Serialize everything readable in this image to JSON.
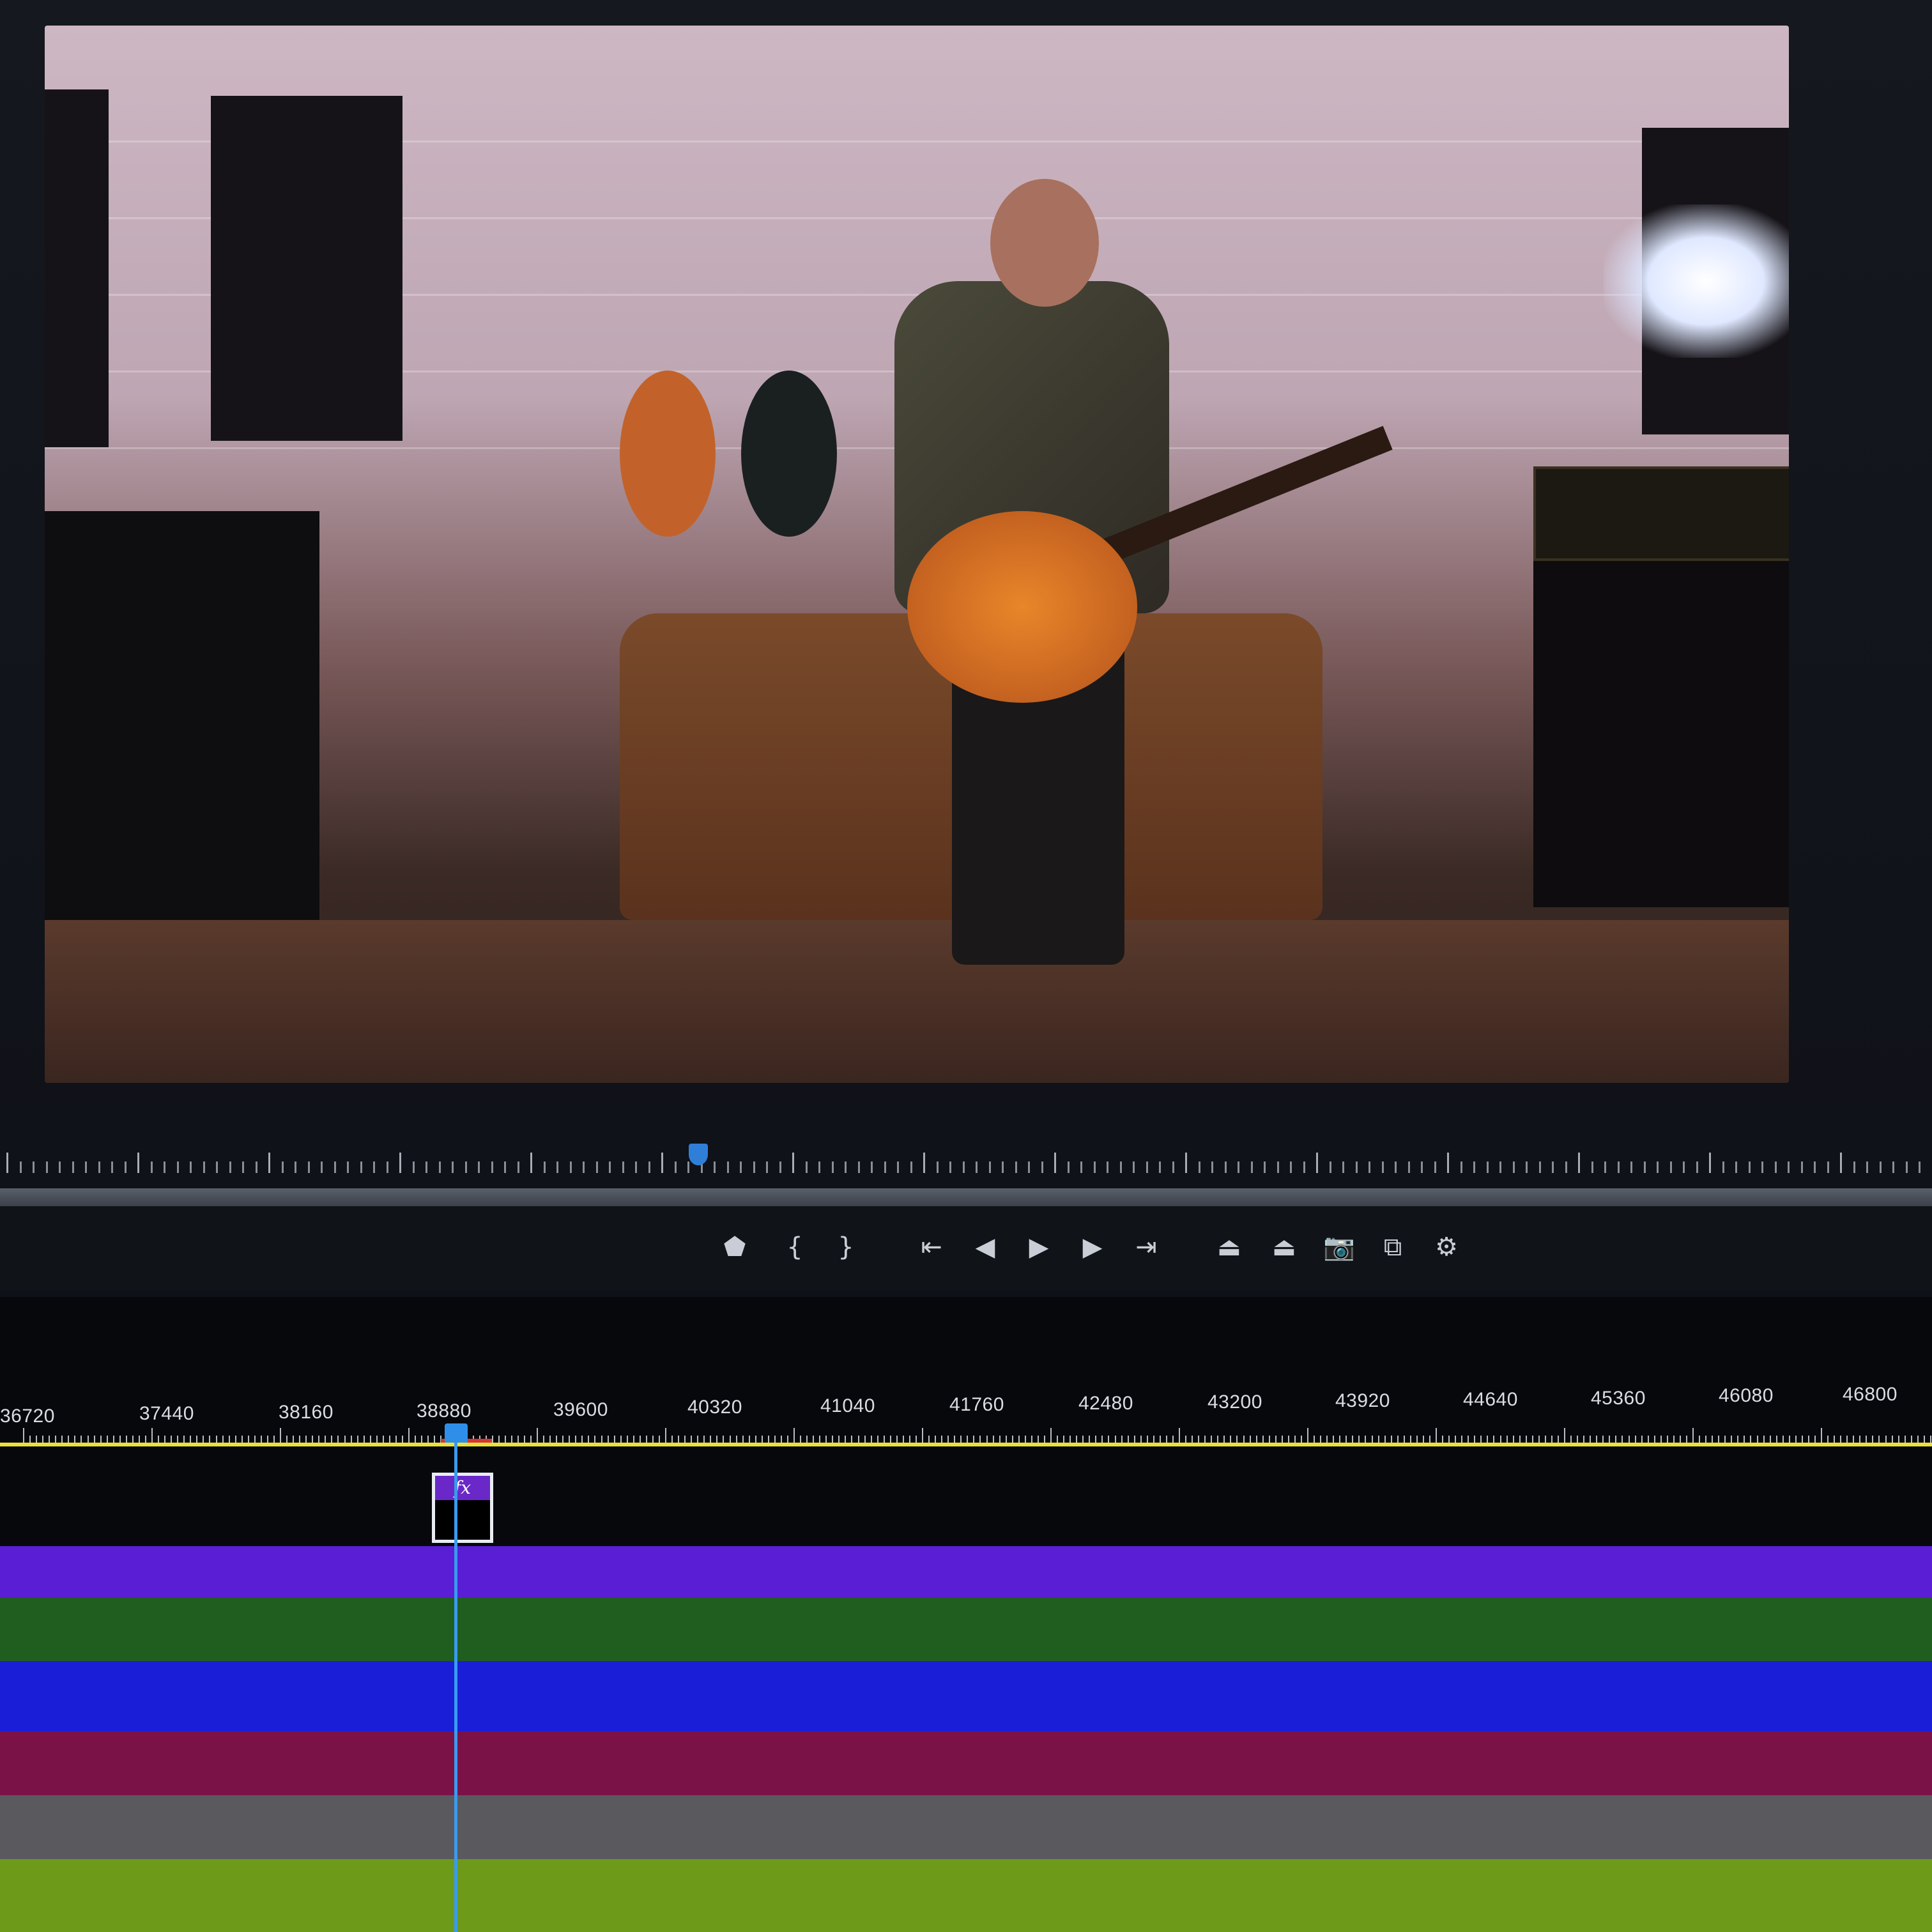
{
  "app": {
    "window": "video-editor"
  },
  "program_monitor": {
    "frame_description_colors": {
      "wall": "#cdb7c3",
      "floor": "#3a2620",
      "guitar": "#e8862a"
    }
  },
  "transport_controls": {
    "icons": [
      "add-marker-icon",
      "mark-in-icon",
      "mark-out-icon",
      "go-to-in-icon",
      "step-back-icon",
      "play-icon",
      "step-forward-icon",
      "go-to-out-icon",
      "lift-icon",
      "extract-icon",
      "export-frame-icon",
      "overlay-icon",
      "settings-icon"
    ],
    "glyphs": {
      "add_marker": "⬟",
      "mark_in": "{",
      "mark_out": "}",
      "go_to_in": "⇤",
      "step_back": "◀",
      "play": "▶",
      "step_forward": "▶",
      "go_to_out": "⇥",
      "lift": "⏏",
      "extract": "⏏",
      "export_frame": "📷",
      "overlay": "⧉",
      "settings": "⚙"
    }
  },
  "timeline": {
    "ruler_labels": [
      "36720",
      "37440",
      "38160",
      "38880",
      "39600",
      "40320",
      "41040",
      "41760",
      "42480",
      "43200",
      "43920",
      "44640",
      "45360",
      "46080",
      "46800"
    ],
    "fx_badge": "fx",
    "tracks": [
      {
        "name": "purple-track",
        "color": "#5a1ed4"
      },
      {
        "name": "green-track",
        "color": "#1f5e1f"
      },
      {
        "name": "blue-track",
        "color": "#1a1ed6"
      },
      {
        "name": "magenta-track",
        "color": "#7a1248"
      },
      {
        "name": "gray-track",
        "color": "#5a5a5e"
      },
      {
        "name": "lime-track",
        "color": "#6e9a1a"
      }
    ],
    "colors": {
      "work_area": "#e8e23a",
      "playhead": "#3a9af0",
      "in_out": "#d83434"
    }
  }
}
